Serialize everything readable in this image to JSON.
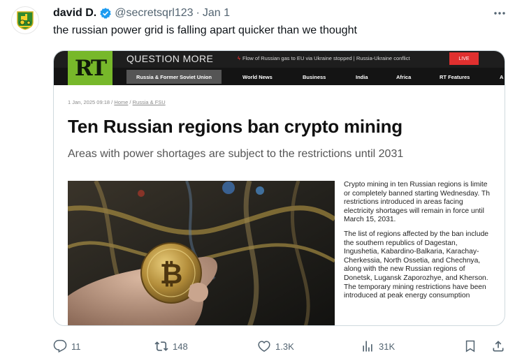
{
  "tweet": {
    "display_name": "david D.",
    "handle": "@secretsqrl123",
    "separator": "·",
    "date": "Jan 1",
    "text": "the russian power grid is falling apart quicker than we thought"
  },
  "article": {
    "logo": "RT",
    "tagline": "QUESTION MORE",
    "ticker": "Flow of Russian gas to EU via Ukraine stopped | Russia-Ukraine conflict",
    "live_label": "LIVE",
    "nav": [
      "Russia & Former Soviet Union",
      "World News",
      "Business",
      "India",
      "Africa",
      "RT Features",
      "A"
    ],
    "date": "1 Jan, 2025 09:18",
    "crumb_sep": " / ",
    "breadcrumbs": [
      "Home",
      "Russia & FSU"
    ],
    "headline": "Ten Russian regions ban crypto mining",
    "subheadline": "Areas with power shortages are subject to the restrictions until 2031",
    "paragraph1": [
      "Crypto mining in ten Russian regions is limite",
      "or completely banned starting Wednesday. Th",
      "restrictions introduced in areas facing",
      "electricity shortages will remain in force until",
      "March 15, 2031."
    ],
    "paragraph2": [
      "The list of regions affected by the ban include",
      "the southern republics of Dagestan,",
      "Ingushetia, Kabardino-Balkaria, Karachay-",
      "Cherkessia, North Ossetia, and Chechnya,",
      "along with the new Russian regions of",
      "Donetsk, Lugansk Zaporozhye, and Kherson.",
      "The temporary mining restrictions have been",
      "introduced at peak energy consumption"
    ]
  },
  "actions": {
    "replies": "11",
    "reposts": "148",
    "likes": "1.3K",
    "views": "31K"
  },
  "icons": {
    "avatar": "tractor-logo",
    "verified": "verified-badge-icon",
    "more": "more-icon",
    "reply": "reply-icon",
    "repost": "repost-icon",
    "like": "heart-icon",
    "views": "views-icon",
    "bookmark": "bookmark-icon",
    "share": "share-icon"
  },
  "colors": {
    "verified_blue": "#1d9bf0",
    "rt_green": "#77b82a",
    "live_red": "#e0302f",
    "muted_text": "#536471"
  }
}
